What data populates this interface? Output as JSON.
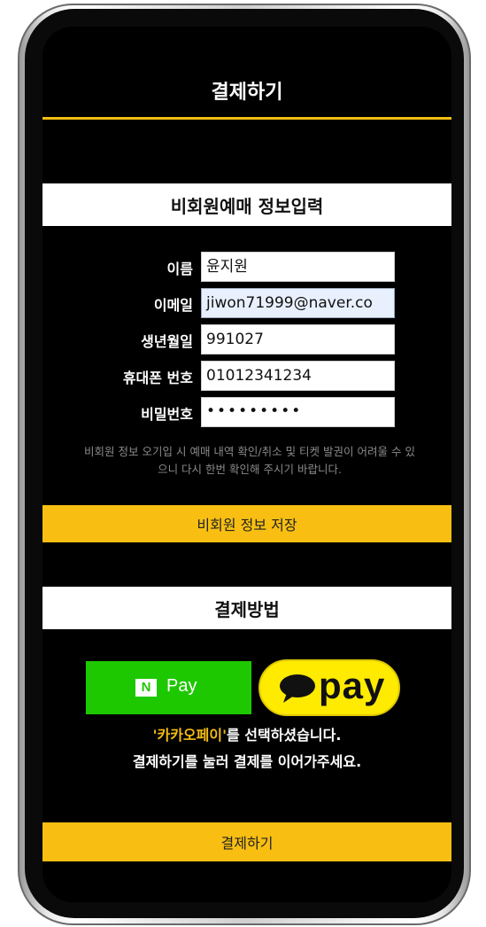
{
  "header": {
    "title": "결제하기"
  },
  "guest_form": {
    "section_title": "비회원예매 정보입력",
    "fields": [
      {
        "label": "이름",
        "value": "윤지원"
      },
      {
        "label": "이메일",
        "value": "jiwon71999@naver.co"
      },
      {
        "label": "생년월일",
        "value": "991027"
      },
      {
        "label": "휴대폰 번호",
        "value": "01012341234"
      },
      {
        "label": "비밀번호",
        "value": "•••••••••"
      }
    ],
    "notice_line1": "비회원 정보 오기입 시 예매 내역 확인/취소 및 티켓 발권이 어려울 수 있",
    "notice_line2": "으니 다시 한번 확인해 주시기 바랍니다.",
    "save_button": "비회원 정보 저장"
  },
  "payment": {
    "section_title": "결제방법",
    "npay_logo": "N",
    "npay_label": "Pay",
    "kakaopay_label": "pay",
    "selected_name": "'카카오페이'",
    "selected_suffix": "를 선택하셨습니다.",
    "instruction": "결제하기를 눌러 결제를 이어가주세요.",
    "pay_button": "결제하기"
  },
  "colors": {
    "accent": "#f8bf12",
    "npay_green": "#1ec800",
    "kakao_yellow": "#ffeb00"
  }
}
